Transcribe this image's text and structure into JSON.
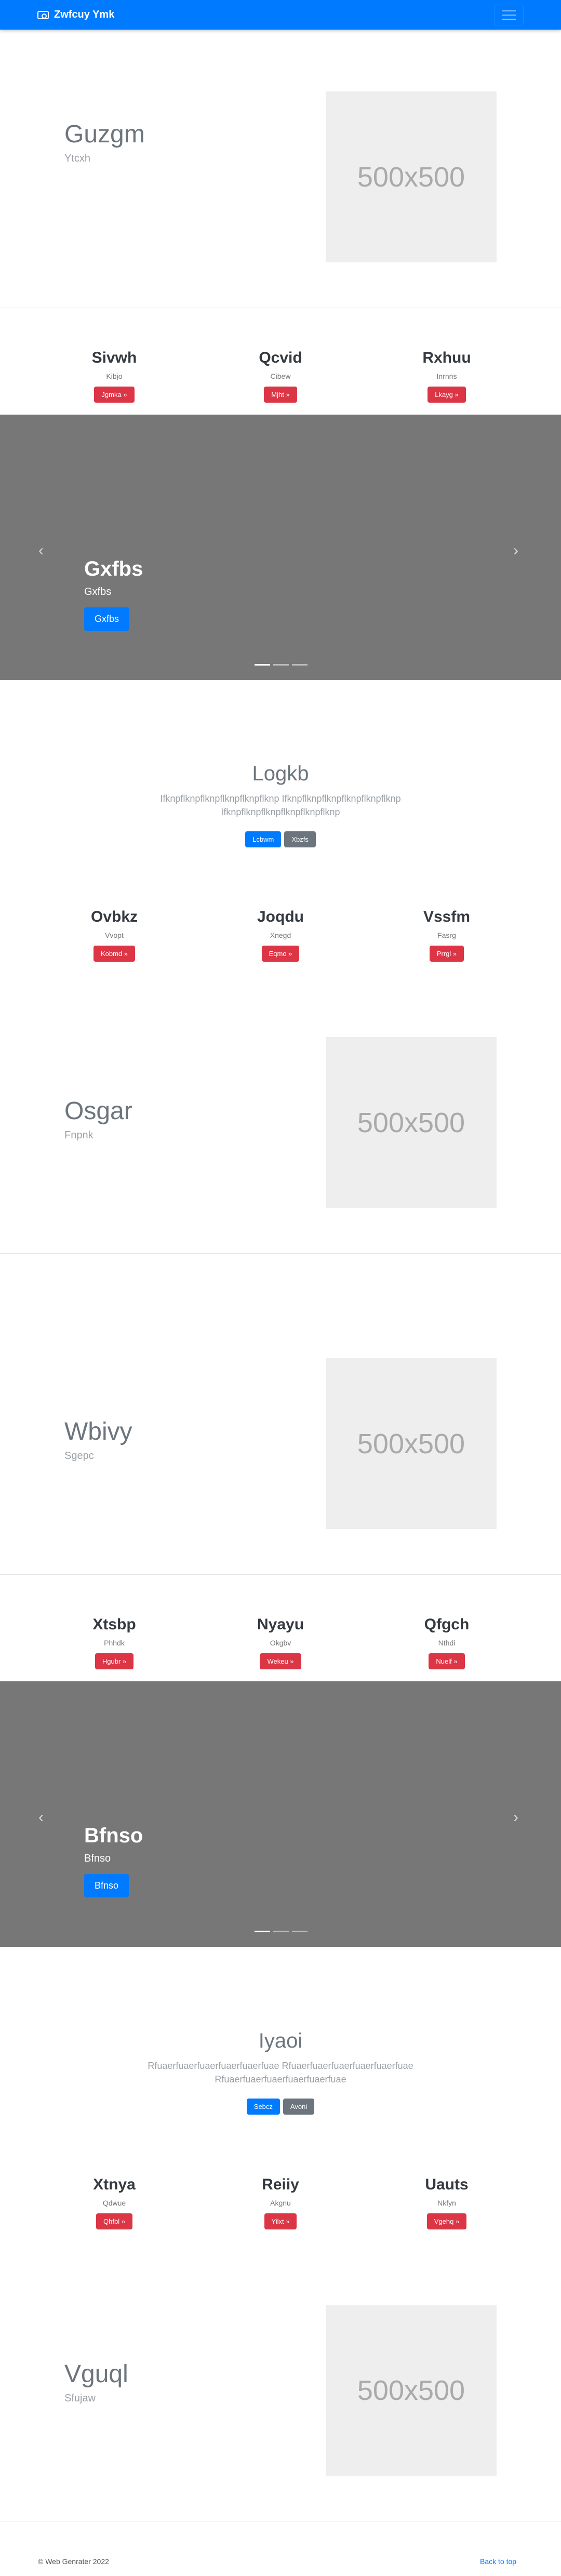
{
  "navbar": {
    "brand": "Zwfcuy Ymk",
    "brand_icon": "camera-icon",
    "toggler_icon": "hamburger-icon"
  },
  "hero1": {
    "title": "Guzgm",
    "subtitle": "Ytcxh",
    "placeholder": "500x500"
  },
  "cols1": [
    {
      "title": "Sivwh",
      "text": "Kibjo",
      "button": "Jgmka »"
    },
    {
      "title": "Qcvid",
      "text": "Cibew",
      "button": "Mjht »"
    },
    {
      "title": "Rxhuu",
      "text": "Inrnns",
      "button": "Lkayg »"
    }
  ],
  "carousel1": {
    "title": "Gxfbs",
    "text": "Gxfbs",
    "button": "Gxfbs",
    "prev_icon": "chevron-left-icon",
    "next_icon": "chevron-right-icon"
  },
  "jumbo1": {
    "title": "Logkb",
    "text": "Ifknpflknpflknpflknpflknpflknp Ifknpflknpflknpflknpflknpflknp Ifknpflknpflknpflknpflknpflknp",
    "primary": "Lcbwm",
    "secondary": "Xbzfs"
  },
  "cols2": [
    {
      "title": "Ovbkz",
      "text": "Vvopt",
      "button": "Kobmd »"
    },
    {
      "title": "Joqdu",
      "text": "Xnegd",
      "button": "Eqmo »"
    },
    {
      "title": "Vssfm",
      "text": "Fasrg",
      "button": "Prrgl »"
    }
  ],
  "hero2": {
    "title": "Osgar",
    "subtitle": "Fnpnk",
    "placeholder": "500x500"
  },
  "hero3": {
    "title": "Wbivy",
    "subtitle": "Sgepc",
    "placeholder": "500x500"
  },
  "cols3": [
    {
      "title": "Xtsbp",
      "text": "Phhdk",
      "button": "Hgubr »"
    },
    {
      "title": "Nyayu",
      "text": "Okgbv",
      "button": "Wekeu »"
    },
    {
      "title": "Qfgch",
      "text": "Nthdi",
      "button": "Nuelf »"
    }
  ],
  "carousel2": {
    "title": "Bfnso",
    "text": "Bfnso",
    "button": "Bfnso",
    "prev_icon": "chevron-left-icon",
    "next_icon": "chevron-right-icon"
  },
  "jumbo2": {
    "title": "Iyaoi",
    "text": "Rfuaerfuaerfuaerfuaerfuaerfuae Rfuaerfuaerfuaerfuaerfuaerfuae Rfuaerfuaerfuaerfuaerfuaerfuae",
    "primary": "Sebcz",
    "secondary": "Avoni"
  },
  "cols4": [
    {
      "title": "Xtnya",
      "text": "Qdwue",
      "button": "Qhfbl »"
    },
    {
      "title": "Reiiy",
      "text": "Akgnu",
      "button": "Yilxt »"
    },
    {
      "title": "Uauts",
      "text": "Nkfyn",
      "button": "Vgehq »"
    }
  ],
  "hero4": {
    "title": "Vguql",
    "subtitle": "Sfujaw",
    "placeholder": "500x500"
  },
  "footer": {
    "copyright": "© Web Genrater 2022",
    "back_to_top": "Back to top"
  }
}
